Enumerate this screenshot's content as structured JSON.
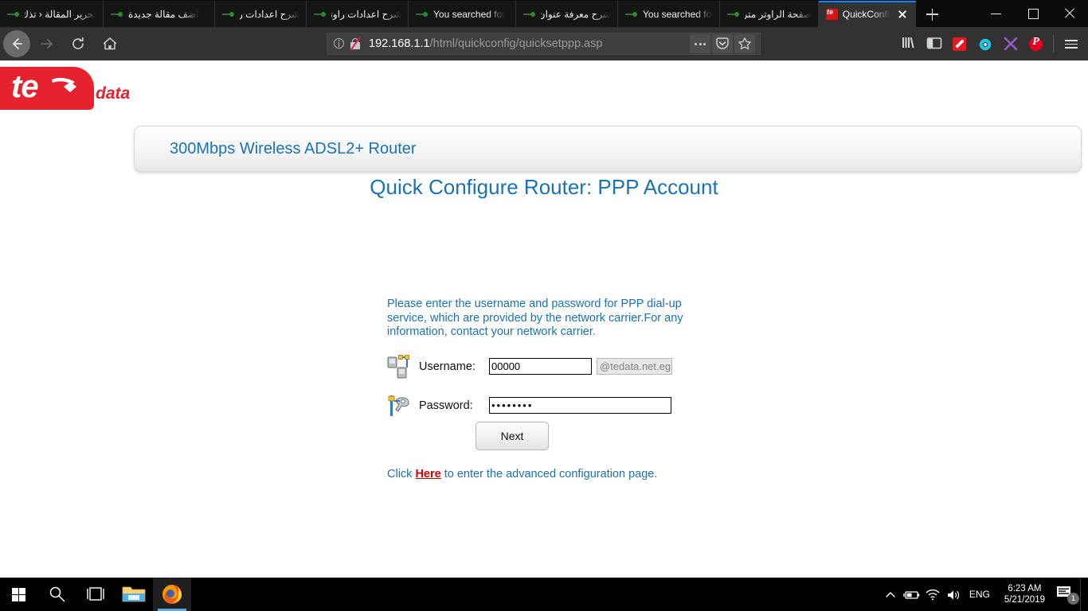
{
  "browser": {
    "tabs": [
      {
        "title": "تحرير المقالة ‹ تذك",
        "favicon": "bookmark-dot-icon",
        "active": false,
        "rtl": true
      },
      {
        "title": "أضف مقالة جديدة",
        "favicon": "bookmark-dot-icon",
        "active": false,
        "rtl": true
      },
      {
        "title": "شرح اعدادات راوتر",
        "favicon": "bookmark-dot-icon",
        "active": false,
        "rtl": true
      },
      {
        "title": "شرح اعدادات راوتر",
        "favicon": "bookmark-dot-icon",
        "active": false,
        "rtl": true
      },
      {
        "title": "You searched for",
        "favicon": "bookmark-dot-icon",
        "active": false,
        "rtl": false
      },
      {
        "title": "شرح معرفة عنوان",
        "favicon": "bookmark-dot-icon",
        "active": false,
        "rtl": true
      },
      {
        "title": "You searched for",
        "favicon": "bookmark-dot-icon",
        "active": false,
        "rtl": false
      },
      {
        "title": "صفحة الراوتر متر",
        "favicon": "bookmark-dot-icon",
        "active": false,
        "rtl": true
      },
      {
        "title": "QuickConfig",
        "favicon": "tedata-favicon",
        "active": true,
        "rtl": false
      }
    ],
    "new_tab_label": "+",
    "window_controls": {
      "minimize": "−",
      "maximize": "□",
      "close": "×"
    },
    "nav": {
      "back": "back-button",
      "forward": "forward-button",
      "reload": "reload-button",
      "home": "home-button"
    },
    "urlbar": {
      "domain": "192.168.1.1",
      "path": "/html/quickconfig/quicksetppp.asp",
      "identity": "info-icon",
      "security": "broken-lock-icon",
      "actions": [
        "page-actions-ellipsis",
        "pocket-icon",
        "bookmark-star-icon"
      ]
    },
    "toolbar_right": [
      {
        "name": "library-icon",
        "color": "#d7d7d7"
      },
      {
        "name": "sidebar-icon",
        "color": "#d7d7d7"
      },
      {
        "name": "extension-wand-icon",
        "color": "#e01b24"
      },
      {
        "name": "extension-gear-icon",
        "color": "#22c3e0"
      },
      {
        "name": "extension-x-icon",
        "color": "#9b59c6"
      },
      {
        "name": "pinterest-icon",
        "color": "#e60023"
      },
      {
        "name": "app-menu-icon",
        "color": "#e0e0e0"
      }
    ]
  },
  "router": {
    "brand": {
      "logo_te": "te",
      "logo_data": "data",
      "logo_color": "#e8212f"
    },
    "header_title": "300Mbps Wireless ADSL2+ Router",
    "page_title": "Quick Configure Router: PPP Account",
    "intro_text": "Please enter the username and password for PPP dial-up service, which are provided by the network carrier.For any information, contact your network carrier.",
    "form": {
      "username_label": "Username:",
      "username_value": "00000",
      "username_placeholder": "",
      "username_suffix": "@tedata.net.eg",
      "username_icon": "network-computers-icon",
      "password_label": "Password:",
      "password_value": "••••••••",
      "password_placeholder": "",
      "password_icon": "key-wrench-icon",
      "next_button": "Next"
    },
    "advanced": {
      "prefix": "Click ",
      "link": "Here",
      "suffix": " to enter the advanced configuration page."
    },
    "accent_color": "#1a72b8",
    "link_color": "#d80000"
  },
  "taskbar": {
    "start": "windows-start-icon",
    "search": "search-icon",
    "task_view": "task-view-icon",
    "file_explorer": "file-explorer-icon",
    "firefox": "firefox-icon",
    "tray": {
      "chevron": "show-hidden-icons",
      "battery": "battery-icon",
      "wifi": "wifi-icon",
      "volume": "volume-icon",
      "language": "ENG",
      "time": "6:23 AM",
      "date": "5/21/2019",
      "action_center": "action-center-icon",
      "notification_count": "1"
    }
  }
}
